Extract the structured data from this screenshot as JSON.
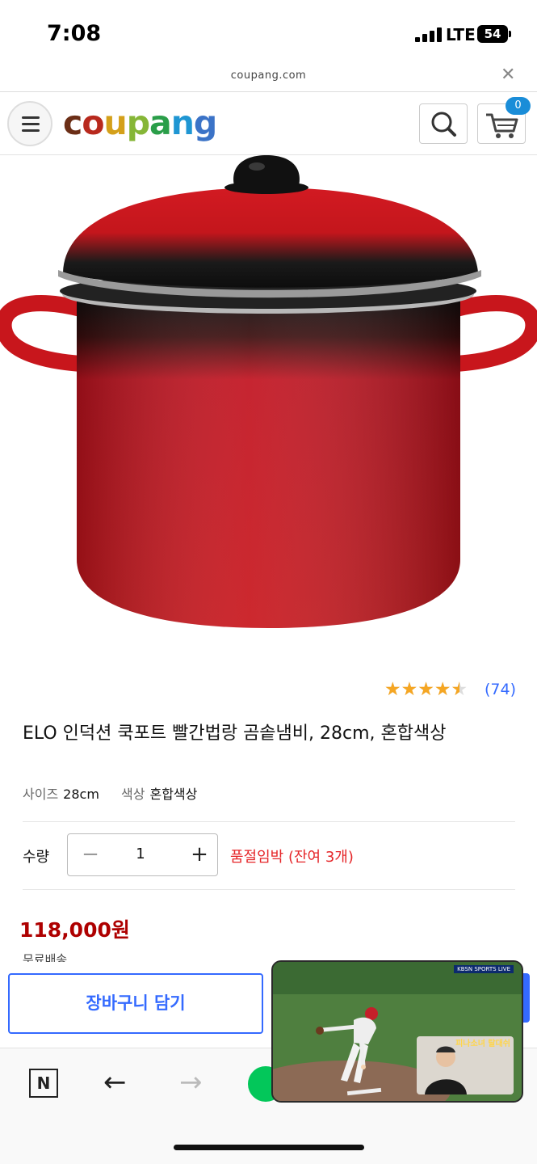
{
  "status_bar": {
    "time": "7:08",
    "network": "LTE",
    "battery": "54"
  },
  "browser": {
    "url": "coupang.com",
    "close_icon": "close-icon"
  },
  "header": {
    "logo": "coupang",
    "cart_count": "0",
    "menu_icon": "hamburger-icon",
    "search_icon": "search-icon",
    "cart_icon": "cart-icon"
  },
  "product": {
    "rating": 4.5,
    "review_count": "(74)",
    "title": "ELO 인덕션 쿡포트 빨간법랑 곰솥냄비, 28cm, 혼합색상",
    "options": [
      {
        "label": "사이즈",
        "value": "28cm"
      },
      {
        "label": "색상",
        "value": "혼합색상"
      }
    ],
    "quantity_label": "수량",
    "quantity": "1",
    "stock_notice": "품절임박 (잔여 3개)",
    "price": "118,000원",
    "shipping": "무료배송"
  },
  "actions": {
    "add_to_cart": "장바구니 담기"
  },
  "toolbar": {
    "n_label": "N"
  },
  "pip": {
    "broadcaster": "KBSN SPORTS LIVE",
    "inset_text": "피나소녀 탈대쉬"
  },
  "colors": {
    "accent": "#346aff",
    "price": "#ae0000",
    "stock": "#e52528",
    "star": "#f5a623"
  }
}
